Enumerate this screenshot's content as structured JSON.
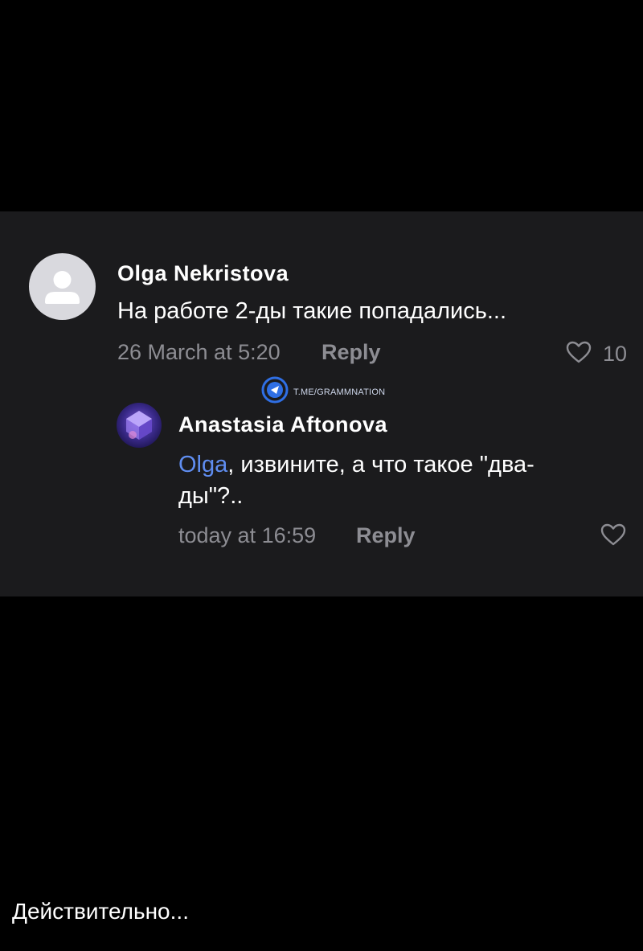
{
  "comments": [
    {
      "author": "Olga Nekristova",
      "text": "На работе 2-ды такие попадались...",
      "timestamp": "26 March at 5:20",
      "reply_label": "Reply",
      "like_count": "10",
      "avatar_icon": "user-placeholder-icon",
      "heart_icon": "heart-outline-icon"
    },
    {
      "author": "Anastasia Aftonova",
      "mention": "Olga",
      "text": ", извините, а что такое \"два-ды\"?..",
      "timestamp": "today at 16:59",
      "reply_label": "Reply",
      "avatar_icon": "purple-cube-avatar",
      "heart_icon": "heart-outline-icon"
    }
  ],
  "watermark": {
    "text": "T.ME/GRAMMNATION",
    "icon": "grammnation-logo-icon"
  },
  "caption": "Действительно...",
  "colors": {
    "background": "#000000",
    "panel": "#1b1b1d",
    "text": "#ffffff",
    "muted": "#8d8d93",
    "mention": "#5f8df0"
  }
}
